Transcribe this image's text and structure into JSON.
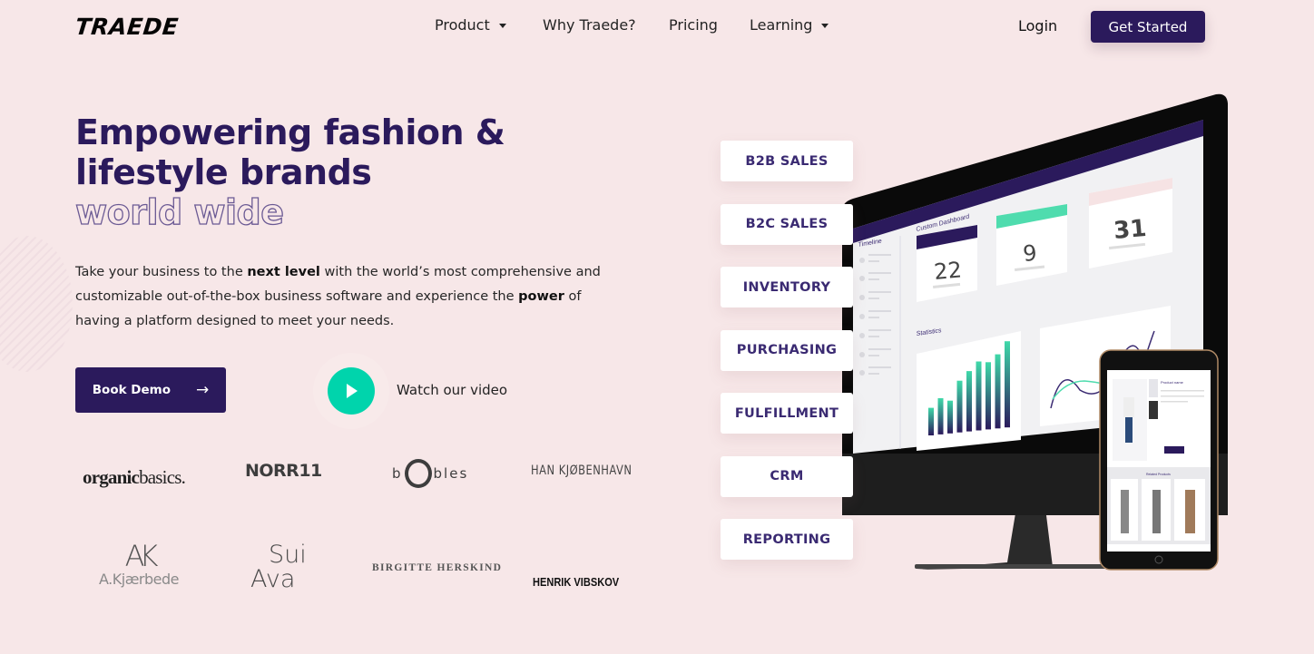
{
  "nav": {
    "logo": "TRAEDE",
    "items": [
      {
        "label": "Product",
        "has_dropdown": true
      },
      {
        "label": "Why Traede?",
        "has_dropdown": false
      },
      {
        "label": "Pricing",
        "has_dropdown": false
      },
      {
        "label": "Learning",
        "has_dropdown": true
      }
    ],
    "login_label": "Login",
    "cta_label": "Get Started"
  },
  "hero": {
    "headline_line1": "Empowering fashion &",
    "headline_line2": "lifestyle brands",
    "headline_outline": "world wide",
    "lead_pre": "Take your business to the ",
    "lead_bold1": "next level",
    "lead_mid": " with the world’s most comprehensive and customizable out-of-the-box business software and experience the ",
    "lead_bold2": "power",
    "lead_post": " of having a platform designed to meet your needs.",
    "book_demo_label": "Book Demo",
    "book_demo_icon": "arrow-right-icon",
    "video_label": "Watch our video",
    "video_icon": "play-icon"
  },
  "brands": {
    "organic_a": "organic",
    "organic_b": "basics.",
    "norr": "NORR11",
    "bobles_a": "b",
    "bobles_b": "bles",
    "han": "HAN KJØBENHAVN",
    "akj_mono": "AK",
    "akj_name": "A.Kjærbede",
    "sui_1": "Sui",
    "sui_2": "Ava",
    "birgitte": "BIRGITTE HERSKIND",
    "henrik": "HENRIK VIBSKOV"
  },
  "features": [
    "B2B SALES",
    "B2C SALES",
    "INVENTORY",
    "PURCHASING",
    "FULFILLMENT",
    "CRM",
    "REPORTING"
  ],
  "dashboard": {
    "timeline_label": "Timeline",
    "custom_dashboard_label": "Custom Dashboard",
    "statistics_label": "Statistics",
    "kpis": [
      {
        "value": "22",
        "color": "#2b1a5c"
      },
      {
        "value": "9",
        "color": "#4fdcae"
      },
      {
        "value": "31",
        "color": "#f6e3e4"
      }
    ],
    "bar_values": [
      0.32,
      0.42,
      0.38,
      0.6,
      0.7,
      0.8,
      0.78,
      0.86,
      1.0
    ],
    "tablet_product_label": "Product name",
    "tablet_related_label": "Related Products"
  },
  "colors": {
    "brand_purple": "#2b1a5c",
    "accent_green": "#00d4ac",
    "background": "#f7e7e8"
  }
}
